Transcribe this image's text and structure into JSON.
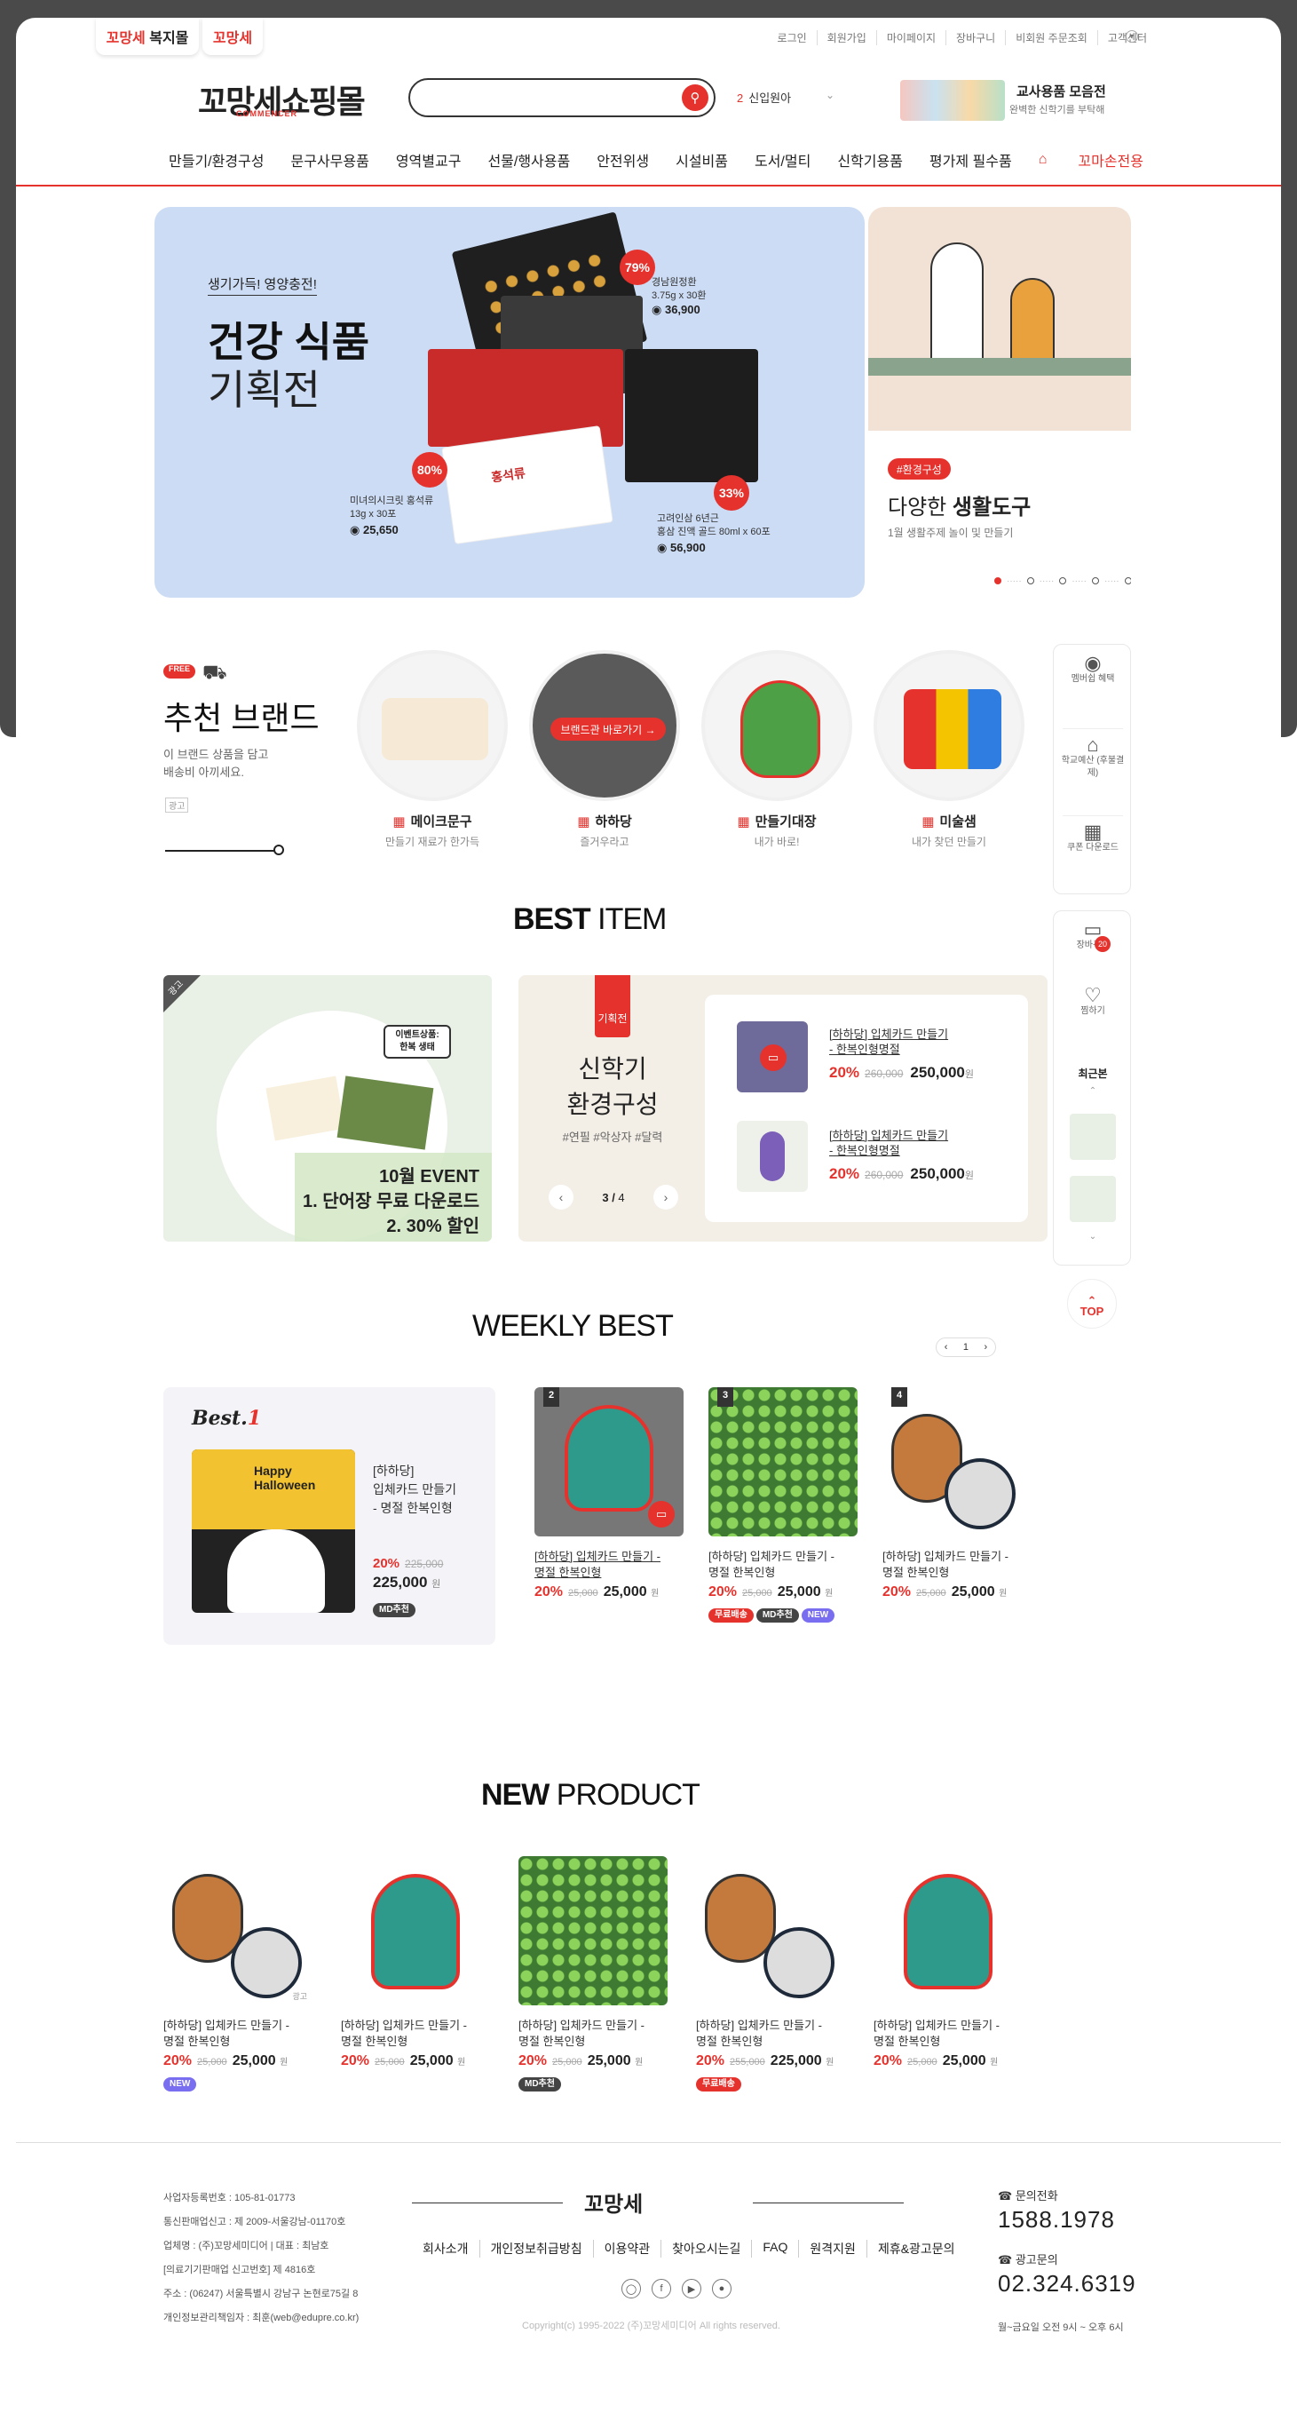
{
  "header": {
    "site_tabs": [
      {
        "label_a": "꼬망세",
        "label_b": "복지몰"
      },
      {
        "label_a": "꼬망세",
        "label_b": ""
      }
    ],
    "util_links": [
      "로그인",
      "회원가입",
      "마이페이지",
      "장바구니",
      "비회원 주문조회",
      "고객센터"
    ],
    "logo": "꼬망세쇼핑몰",
    "logo_sub": "COMMENCER",
    "search_placeholder": "",
    "rank_num": "2",
    "rank_text": "신입원아",
    "promo_title": "교사용품 모음전",
    "promo_sub": "완벽한 신학기를 부탁해"
  },
  "gnb": [
    "만들기/환경구성",
    "문구사무용품",
    "영역별교구",
    "선물/행사용품",
    "안전위생",
    "시설비품",
    "도서/멀티",
    "신학기용품",
    "평가제 필수품"
  ],
  "gnb_special": "꼬마손전용",
  "hero": {
    "subtitle": "생기가득! 영양충전!",
    "title1": "건강 식품",
    "title2": "기획전",
    "products": [
      {
        "pct": "79%",
        "name1": "경남원정환",
        "name2": "3.75g x 30환",
        "price": "36,900"
      },
      {
        "pct": "80%",
        "name1": "미녀의시크릿 홍석류",
        "name2": "13g x 30포",
        "price": "25,650"
      },
      {
        "pct": "33%",
        "name1": "고려인삼 6년근",
        "name2": "홍삼 진액 골드 80ml x 60포",
        "price": "56,900"
      }
    ],
    "box_label": "홍석류"
  },
  "side_banner": {
    "tag": "#환경구성",
    "title_light": "다양한",
    "title_bold": "생활도구",
    "desc": "1월 생활주제 놀이 및 만들기",
    "slide_count": 5,
    "active_slide": 1
  },
  "brand": {
    "free": "FREE",
    "title": "추천 브랜드",
    "desc1": "이 브랜드 상품을 담고",
    "desc2": "배송비 아끼세요.",
    "ad": "광고",
    "slider_position": 0.95,
    "hover_button": "브랜드관 바로가기 →",
    "items": [
      {
        "name": "메이크문구",
        "sub": "만들기 재료가 한가득"
      },
      {
        "name": "하하당",
        "sub": "즐거우라고"
      },
      {
        "name": "만들기대장",
        "sub": "내가 바로!"
      },
      {
        "name": "미술샘",
        "sub": "내가 찾던 만들기"
      }
    ]
  },
  "quick": {
    "items": [
      "멤버쉽 혜택",
      "학교예산 (후불결제)",
      "쿠폰 다운로드"
    ],
    "cart": "장바구니",
    "cart_count": "20",
    "wish": "찜하기",
    "recent": "최근본",
    "top": "TOP"
  },
  "best_item": {
    "title_bold": "BEST",
    "title_light": "ITEM",
    "ad": "광고",
    "bubble1": "이벤트상품:",
    "bubble2": "한복 생태",
    "event1": "10월 EVENT",
    "event2": "1. 단어장 무료 다운로드",
    "event3": "2. 30% 할인",
    "plan_flag": "기획전",
    "plan_t1": "신학기",
    "plan_t2": "환경구성",
    "plan_tags": "#연필 #악상자 #달력",
    "plan_page": "3",
    "plan_total": "4",
    "plan_products": [
      {
        "name1": "[하하당] 입체카드 만들기",
        "name2": "- 한복인형명절",
        "pct": "20%",
        "orig": "260,000",
        "price": "250,000",
        "unit": "원"
      },
      {
        "name1": "[하하당] 입체카드 만들기",
        "name2": "- 한복인형명절",
        "pct": "20%",
        "orig": "260,000",
        "price": "250,000",
        "unit": "원"
      }
    ]
  },
  "weekly": {
    "title_bold": "WEEKLY",
    "title_light": "BEST",
    "page": "1",
    "best1": {
      "label": "Best.",
      "num": "1",
      "name1": "[하하당]",
      "name2": "입체카드 만들기",
      "name3": "- 명절 한복인형",
      "pct": "20%",
      "orig": "225,000",
      "price": "225,000",
      "unit": "원",
      "badge": "MD추천",
      "img_text1": "Happy",
      "img_text2": "Halloween"
    },
    "items": [
      {
        "rank": "2",
        "name1": "[하하당] 입체카드 만들기 -",
        "name2": "명절 한복인형",
        "pct": "20%",
        "orig": "25,000",
        "price": "25,000",
        "unit": "원",
        "badges": []
      },
      {
        "rank": "3",
        "name1": "[하하당] 입체카드 만들기 -",
        "name2": "명절 한복인형",
        "pct": "20%",
        "orig": "25,000",
        "price": "25,000",
        "unit": "원",
        "badges": [
          "무료배송",
          "MD추천",
          "NEW"
        ]
      },
      {
        "rank": "4",
        "name1": "[하하당] 입체카드 만들기 -",
        "name2": "명절 한복인형",
        "pct": "20%",
        "orig": "25,000",
        "price": "25,000",
        "unit": "원",
        "badges": []
      }
    ]
  },
  "new_product": {
    "title_bold": "NEW",
    "title_light": "PRODUCT",
    "ad": "광고",
    "items": [
      {
        "name1": "[하하당] 입체카드 만들기 -",
        "name2": "명절 한복인형",
        "pct": "20%",
        "orig": "25,000",
        "price": "25,000",
        "unit": "원",
        "badge": "NEW"
      },
      {
        "name1": "[하하당] 입체카드 만들기 -",
        "name2": "명절 한복인형",
        "pct": "20%",
        "orig": "25,000",
        "price": "25,000",
        "unit": "원",
        "badge": ""
      },
      {
        "name1": "[하하당] 입체카드 만들기 -",
        "name2": "명절 한복인형",
        "pct": "20%",
        "orig": "25,000",
        "price": "25,000",
        "unit": "원",
        "badge": "MD추천"
      },
      {
        "name1": "[하하당] 입체카드 만들기 -",
        "name2": "명절 한복인형",
        "pct": "20%",
        "orig": "255,000",
        "price": "225,000",
        "unit": "원",
        "badge": "무료배송"
      },
      {
        "name1": "[하하당] 입체카드 만들기 -",
        "name2": "명절 한복인형",
        "pct": "20%",
        "orig": "25,000",
        "price": "25,000",
        "unit": "원",
        "badge": ""
      }
    ]
  },
  "footer": {
    "info": [
      "사업자등록번호 : 105-81-01773",
      "통신판매업신고 : 제 2009-서울강남-01170호",
      "업체명 : (주)꼬망세미디어 | 대표 : 최남호",
      "[의료기기판매업 신고번호] 제 4816호",
      "주소 : (06247) 서울특별시 강남구 논현로75길 8",
      "개인정보관리책임자 : 최훈(web@edupre.co.kr)"
    ],
    "logo": "꼬망세",
    "links": [
      "회사소개",
      "개인정보취급방침",
      "이용약관",
      "찾아오시는길",
      "FAQ",
      "원격지원",
      "제휴&광고문의"
    ],
    "sns": [
      "instagram-icon",
      "facebook-icon",
      "youtube-icon",
      "kakao-icon"
    ],
    "copyright": "Copyright(c) 1995-2022 (주)꼬망세미디어 All rights reserved.",
    "cs_label1": "문의전화",
    "cs_num1": "1588.1978",
    "cs_label2": "광고문의",
    "cs_num2": "02.324.6319",
    "hours": "월~금요일 오전 9시 ~ 오후 6시"
  },
  "colors": {
    "accent": "#e5322d",
    "hero_bg": "#ccdcf4",
    "plan_bg": "#f3eee6"
  }
}
